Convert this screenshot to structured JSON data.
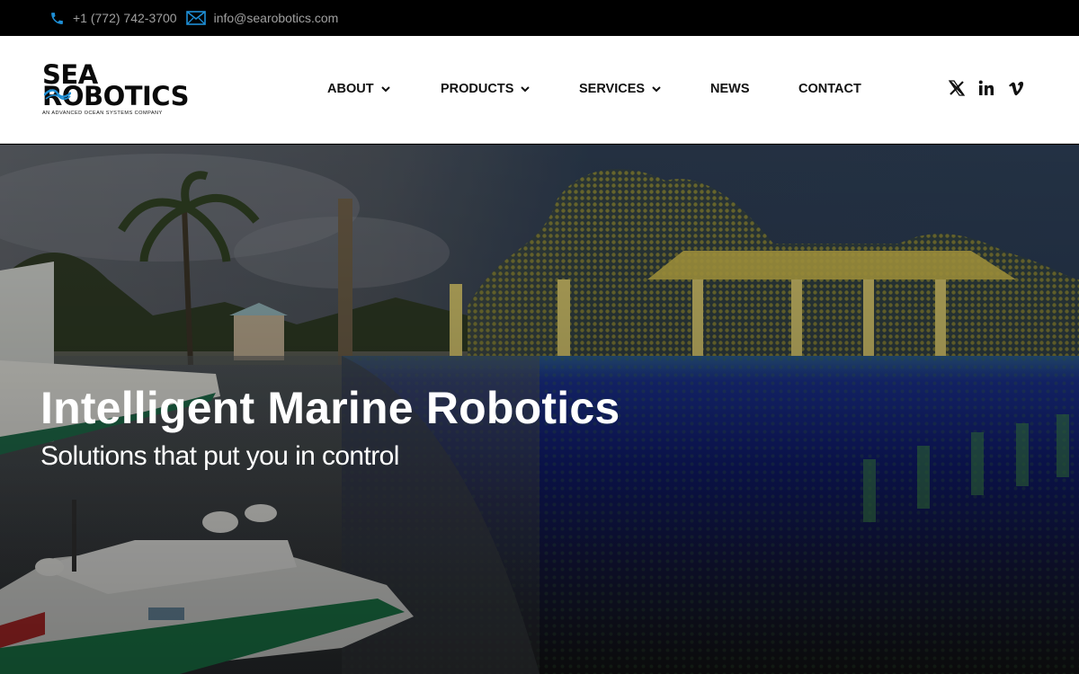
{
  "topbar": {
    "phone": "+1 (772) 742-3700",
    "email": "info@searobotics.com",
    "icons": [
      "phone-icon",
      "envelope-icon"
    ]
  },
  "logo": {
    "line1": "SEA",
    "line2": "ROBOTICS",
    "tagline": "AN ADVANCED OCEAN SYSTEMS COMPANY"
  },
  "nav": {
    "items": [
      {
        "label": "ABOUT",
        "dropdown": true
      },
      {
        "label": "PRODUCTS",
        "dropdown": true
      },
      {
        "label": "SERVICES",
        "dropdown": true
      },
      {
        "label": "NEWS",
        "dropdown": false
      },
      {
        "label": "CONTACT",
        "dropdown": false
      }
    ]
  },
  "social": [
    "x-icon",
    "linkedin-icon",
    "vimeo-icon"
  ],
  "hero": {
    "title": "Intelligent Marine Robotics",
    "subtitle": "Solutions that put you in control"
  },
  "colors": {
    "accent_blue": "#1e8fd6",
    "topbar_bg": "#000000",
    "header_bg": "#ffffff",
    "nav_text": "#111111"
  }
}
